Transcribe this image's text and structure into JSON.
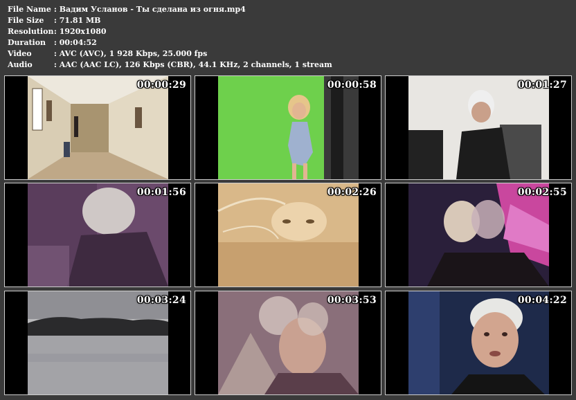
{
  "info": {
    "rows": [
      {
        "label": "File Name",
        "value": "Вадим Усланов - Ты сделана из огня.mp4"
      },
      {
        "label": "File Size",
        "value": "71.81 MB"
      },
      {
        "label": "Resolution",
        "value": "1920x1080"
      },
      {
        "label": "Duration",
        "value": "00:04:52"
      },
      {
        "label": "Video",
        "value": "AVC (AVC), 1 928 Kbps, 25.000 fps"
      },
      {
        "label": "Audio",
        "value": "AAC (AAC LC), 126 Kbps (CBR), 44.1 KHz, 2 channels, 1 stream"
      }
    ]
  },
  "thumbnails": [
    {
      "time": "00:00:29",
      "scene": "corridor"
    },
    {
      "time": "00:00:58",
      "scene": "greenscreen"
    },
    {
      "time": "00:01:27",
      "scene": "studio"
    },
    {
      "time": "00:01:56",
      "scene": "purple-back"
    },
    {
      "time": "00:02:26",
      "scene": "golden-face"
    },
    {
      "time": "00:02:55",
      "scene": "double-face"
    },
    {
      "time": "00:03:24",
      "scene": "lake"
    },
    {
      "time": "00:03:53",
      "scene": "overlay-faces"
    },
    {
      "time": "00:04:22",
      "scene": "singer-closeup"
    }
  ],
  "colors": {
    "background": "#3a3a3a",
    "text": "#ffffff",
    "thumb_border": "#cfcfcf"
  }
}
